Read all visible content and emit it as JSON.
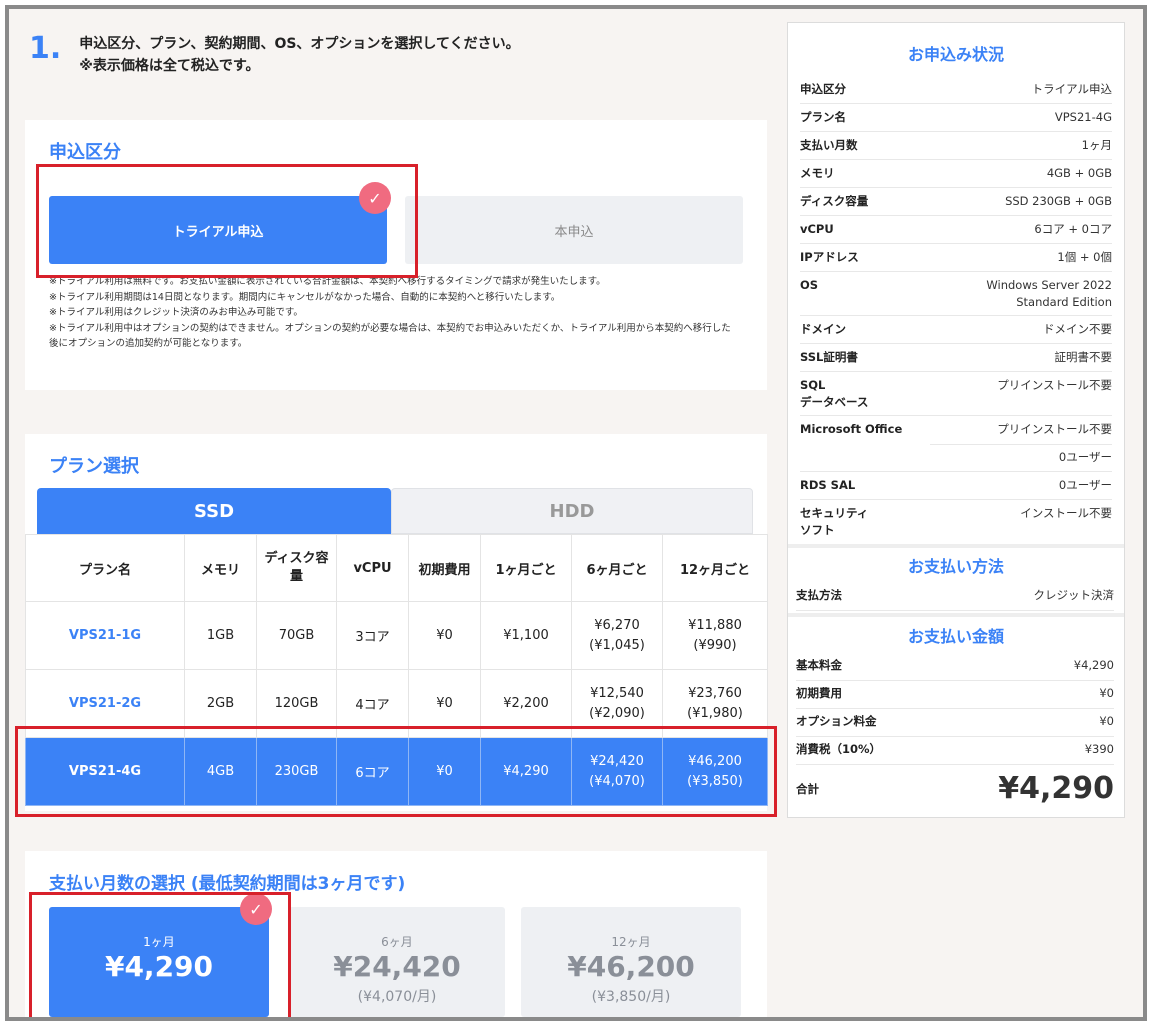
{
  "step": {
    "number": "1.",
    "line1": "申込区分、プラン、契約期間、OS、オプションを選択してください。",
    "line2": "※表示価格は全て税込です。"
  },
  "application": {
    "title": "申込区分",
    "options": [
      "トライアル申込",
      "本申込"
    ],
    "selected_index": 0,
    "notes": [
      "※トライアル利用は無料です。お支払い金額に表示されている合計金額は、本契約へ移行するタイミングで請求が発生いたします。",
      "※トライアル利用期間は14日間となります。期間内にキャンセルがなかった場合、自動的に本契約へと移行いたします。",
      "※トライアル利用はクレジット決済のみお申込み可能です。",
      "※トライアル利用中はオプションの契約はできません。オプションの契約が必要な場合は、本契約でお申込みいただくか、トライアル利用から本契約へ移行した後にオプションの追加契約が可能となります。"
    ]
  },
  "plan": {
    "title": "プラン選択",
    "tabs": [
      "SSD",
      "HDD"
    ],
    "active_tab": 0,
    "headers": [
      "プラン名",
      "メモリ",
      "ディスク容量",
      "vCPU",
      "初期費用",
      "1ヶ月ごと",
      "6ヶ月ごと",
      "12ヶ月ごと"
    ],
    "rows": [
      {
        "name": "VPS21-1G",
        "memory": "1GB",
        "disk": "70GB",
        "vcpu": "3コア",
        "initial": "¥0",
        "m1": "¥1,100",
        "m6": "¥6,270",
        "m6sub": "(¥1,045)",
        "m12": "¥11,880",
        "m12sub": "(¥990)"
      },
      {
        "name": "VPS21-2G",
        "memory": "2GB",
        "disk": "120GB",
        "vcpu": "4コア",
        "initial": "¥0",
        "m1": "¥2,200",
        "m6": "¥12,540",
        "m6sub": "(¥2,090)",
        "m12": "¥23,760",
        "m12sub": "(¥1,980)"
      },
      {
        "name": "VPS21-4G",
        "memory": "4GB",
        "disk": "230GB",
        "vcpu": "6コア",
        "initial": "¥0",
        "m1": "¥4,290",
        "m6": "¥24,420",
        "m6sub": "(¥4,070)",
        "m12": "¥46,200",
        "m12sub": "(¥3,850)"
      }
    ],
    "selected_row": 2
  },
  "months": {
    "title": "支払い月数の選択 (最低契約期間は3ヶ月です)",
    "options": [
      {
        "label": "1ヶ月",
        "price": "¥4,290",
        "sub": ""
      },
      {
        "label": "6ヶ月",
        "price": "¥24,420",
        "sub": "(¥4,070/月)"
      },
      {
        "label": "12ヶ月",
        "price": "¥46,200",
        "sub": "(¥3,850/月)"
      }
    ],
    "selected_index": 0
  },
  "summary": {
    "title": "お申込み状況",
    "rows": [
      {
        "key": "申込区分",
        "value": "トライアル申込"
      },
      {
        "key": "プラン名",
        "value": "VPS21-4G"
      },
      {
        "key": "支払い月数",
        "value": "1ヶ月"
      },
      {
        "key": "メモリ",
        "value": "4GB + 0GB"
      },
      {
        "key": "ディスク容量",
        "value": "SSD 230GB + 0GB"
      },
      {
        "key": "vCPU",
        "value": "6コア + 0コア"
      },
      {
        "key": "IPアドレス",
        "value": "1個 + 0個"
      },
      {
        "key": "OS",
        "value": "Windows Server 2022\nStandard Edition"
      },
      {
        "key": "ドメイン",
        "value": "ドメイン不要"
      },
      {
        "key": "SSL証明書",
        "value": "証明書不要"
      },
      {
        "key": "SQL\nデータベース",
        "value": "プリインストール不要"
      },
      {
        "key": "Microsoft Office",
        "value": "プリインストール不要"
      },
      {
        "key": "",
        "value": "0ユーザー"
      },
      {
        "key": "RDS SAL",
        "value": "0ユーザー"
      },
      {
        "key": "セキュリティ\nソフト",
        "value": "インストール不要"
      }
    ]
  },
  "payment_method": {
    "title": "お支払い方法",
    "key": "支払方法",
    "value": "クレジット決済"
  },
  "payment_amount": {
    "title": "お支払い金額",
    "rows": [
      {
        "key": "基本料金",
        "value": "¥4,290"
      },
      {
        "key": "初期費用",
        "value": "¥0"
      },
      {
        "key": "オプション料金",
        "value": "¥0"
      },
      {
        "key": "消費税（10%）",
        "value": "¥390"
      }
    ],
    "total_key": "合計",
    "total_value": "¥4,290"
  },
  "colors": {
    "accent": "#3b82f6",
    "highlight_border": "#d8202a",
    "check_badge": "#f06b80"
  }
}
